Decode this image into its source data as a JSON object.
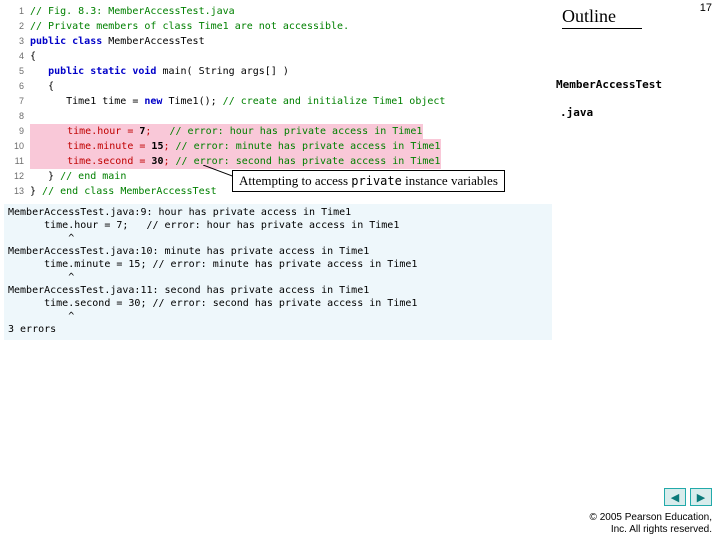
{
  "page_number": "17",
  "outline_label": "Outline",
  "side": {
    "class_name": "MemberAccessTest",
    "ext": ".java"
  },
  "callout": {
    "before": "Attempting to access ",
    "kw": "private",
    "after": " instance variables"
  },
  "code_lines": [
    {
      "n": "1",
      "segs": [
        {
          "cls": "tk-c",
          "t": "// Fig. 8.3: MemberAccessTest.java"
        }
      ]
    },
    {
      "n": "2",
      "segs": [
        {
          "cls": "tk-c",
          "t": "// Private members of class Time1 are not accessible."
        }
      ]
    },
    {
      "n": "3",
      "segs": [
        {
          "cls": "tk-k",
          "t": "public class"
        },
        {
          "cls": "tk-n",
          "t": " MemberAccessTest"
        }
      ]
    },
    {
      "n": "4",
      "segs": [
        {
          "cls": "tk-n",
          "t": "{"
        }
      ]
    },
    {
      "n": "5",
      "segs": [
        {
          "cls": "tk-n",
          "t": "   "
        },
        {
          "cls": "tk-k",
          "t": "public static void"
        },
        {
          "cls": "tk-n",
          "t": " main( String args[] )"
        }
      ]
    },
    {
      "n": "6",
      "segs": [
        {
          "cls": "tk-n",
          "t": "   {"
        }
      ]
    },
    {
      "n": "7",
      "segs": [
        {
          "cls": "tk-n",
          "t": "      Time1 time = "
        },
        {
          "cls": "tk-k",
          "t": "new"
        },
        {
          "cls": "tk-n",
          "t": " Time1(); "
        },
        {
          "cls": "tk-c",
          "t": "// create and initialize Time1 object"
        }
      ]
    },
    {
      "n": "8",
      "segs": [
        {
          "cls": "tk-n",
          "t": ""
        }
      ]
    },
    {
      "n": "9",
      "hl": true,
      "segs": [
        {
          "cls": "tk-n",
          "t": "      "
        },
        {
          "cls": "tk-err",
          "t": "time.hour = "
        },
        {
          "cls": "tk-d",
          "t": "7"
        },
        {
          "cls": "tk-err",
          "t": ";   "
        },
        {
          "cls": "tk-c",
          "t": "// error: hour has private access in Time1"
        }
      ]
    },
    {
      "n": "10",
      "hl": true,
      "segs": [
        {
          "cls": "tk-n",
          "t": "      "
        },
        {
          "cls": "tk-err",
          "t": "time.minute = "
        },
        {
          "cls": "tk-d",
          "t": "15"
        },
        {
          "cls": "tk-err",
          "t": "; "
        },
        {
          "cls": "tk-c",
          "t": "// error: minute has private access in Time1"
        }
      ]
    },
    {
      "n": "11",
      "hl": true,
      "segs": [
        {
          "cls": "tk-n",
          "t": "      "
        },
        {
          "cls": "tk-err",
          "t": "time.second = "
        },
        {
          "cls": "tk-d",
          "t": "30"
        },
        {
          "cls": "tk-err",
          "t": "; "
        },
        {
          "cls": "tk-c",
          "t": "// error: second has private access in Time1"
        }
      ]
    },
    {
      "n": "12",
      "segs": [
        {
          "cls": "tk-n",
          "t": "   } "
        },
        {
          "cls": "tk-c",
          "t": "// end main"
        }
      ]
    },
    {
      "n": "13",
      "segs": [
        {
          "cls": "tk-n",
          "t": "} "
        },
        {
          "cls": "tk-c",
          "t": "// end class MemberAccessTest"
        }
      ]
    }
  ],
  "compiler_output": "MemberAccessTest.java:9: hour has private access in Time1\n      time.hour = 7;   // error: hour has private access in Time1\n          ^\nMemberAccessTest.java:10: minute has private access in Time1\n      time.minute = 15; // error: minute has private access in Time1\n          ^\nMemberAccessTest.java:11: second has private access in Time1\n      time.second = 30; // error: second has private access in Time1\n          ^\n3 errors",
  "nav": {
    "prev": "◀",
    "next": "▶"
  },
  "copyright": {
    "line1": "© 2005 Pearson Education,",
    "line2": "Inc.  All rights reserved."
  }
}
